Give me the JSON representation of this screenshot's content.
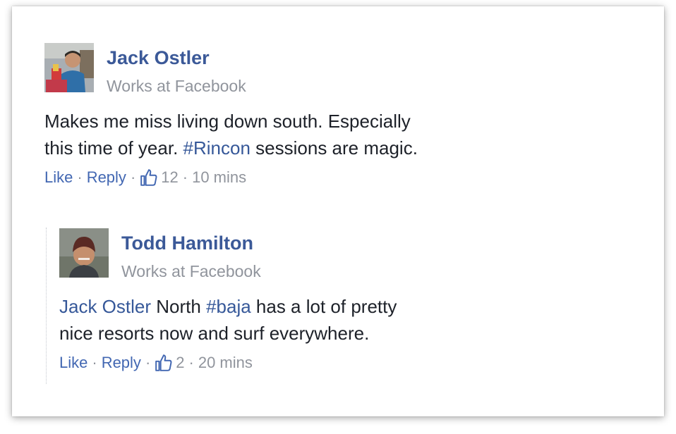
{
  "comments": [
    {
      "author": "Jack Ostler",
      "subtitle": "Works at Facebook",
      "text_line1": "Makes me miss living down south. Especially",
      "text_line2_pre": "this time of year. ",
      "hashtag": "#Rincon",
      "text_line2_post": " sessions are magic.",
      "like_label": "Like",
      "reply_label": "Reply",
      "like_count": "12",
      "time": "10 mins"
    },
    {
      "author": "Todd Hamilton",
      "subtitle": "Works at Facebook",
      "mention": "Jack Ostler",
      "text_line1_mid": " North ",
      "hashtag": "#baja",
      "text_line1_post": " has a lot of pretty",
      "text_line2": "nice resorts now and surf everywhere.",
      "like_label": "Like",
      "reply_label": "Reply",
      "like_count": "2",
      "time": "20 mins"
    }
  ],
  "separator": "·",
  "icons": {
    "thumb": "thumbs-up-icon",
    "avatar": "avatar"
  },
  "colors": {
    "name": "#3b5998",
    "link": "#365899",
    "action": "#4267b2",
    "meta": "#90949c",
    "text": "#1d2129"
  }
}
